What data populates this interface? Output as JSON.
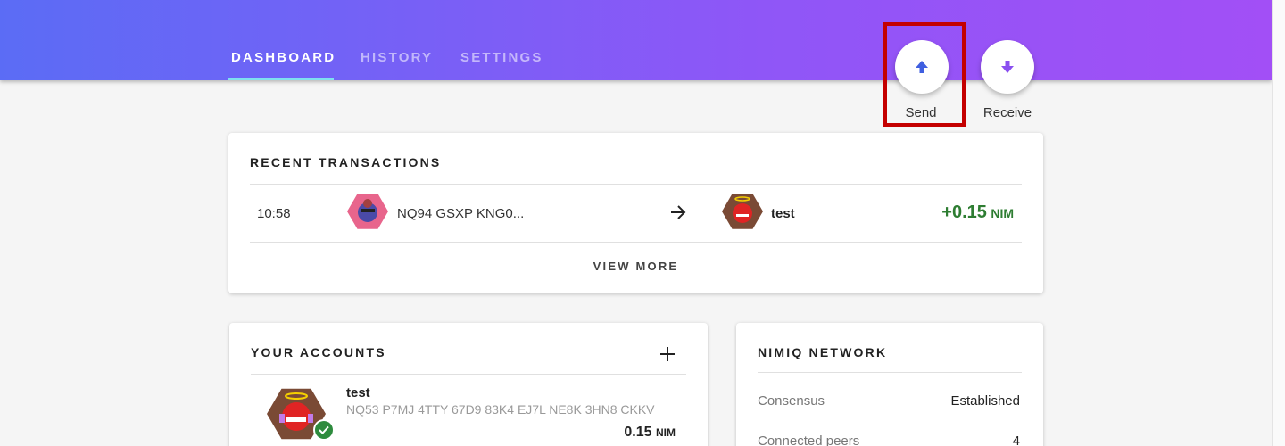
{
  "nav": {
    "tabs": [
      {
        "label": "DASHBOARD",
        "active": true
      },
      {
        "label": "HISTORY",
        "active": false
      },
      {
        "label": "SETTINGS",
        "active": false
      }
    ]
  },
  "actions": {
    "send_label": "Send",
    "receive_label": "Receive"
  },
  "recent_transactions": {
    "title": "RECENT TRANSACTIONS",
    "rows": [
      {
        "time": "10:58",
        "from_address": "NQ94 GSXP KNG0...",
        "to_name": "test",
        "amount": "+0.15",
        "currency": "NIM"
      }
    ],
    "view_more_label": "VIEW MORE"
  },
  "your_accounts": {
    "title": "YOUR ACCOUNTS",
    "accounts": [
      {
        "name": "test",
        "address": "NQ53 P7MJ 4TTY 67D9 83K4 EJ7L NE8K 3HN8 CKKV",
        "balance": "0.15",
        "currency": "NIM"
      }
    ]
  },
  "network": {
    "title": "NIMIQ NETWORK",
    "rows": [
      {
        "label": "Consensus",
        "value": "Established"
      },
      {
        "label": "Connected peers",
        "value": "4"
      }
    ]
  },
  "colors": {
    "gradient_start": "#5b6cf5",
    "gradient_end": "#a24ff6",
    "positive_amount": "#2e7d32",
    "send_icon": "#3f5fe0",
    "receive_icon": "#8a4ff0",
    "highlight": "#c40000"
  },
  "icons": {
    "send": "arrow-up-icon",
    "receive": "arrow-down-icon",
    "transfer": "arrow-right-icon",
    "add_account": "plus-icon",
    "verified": "check-icon"
  }
}
